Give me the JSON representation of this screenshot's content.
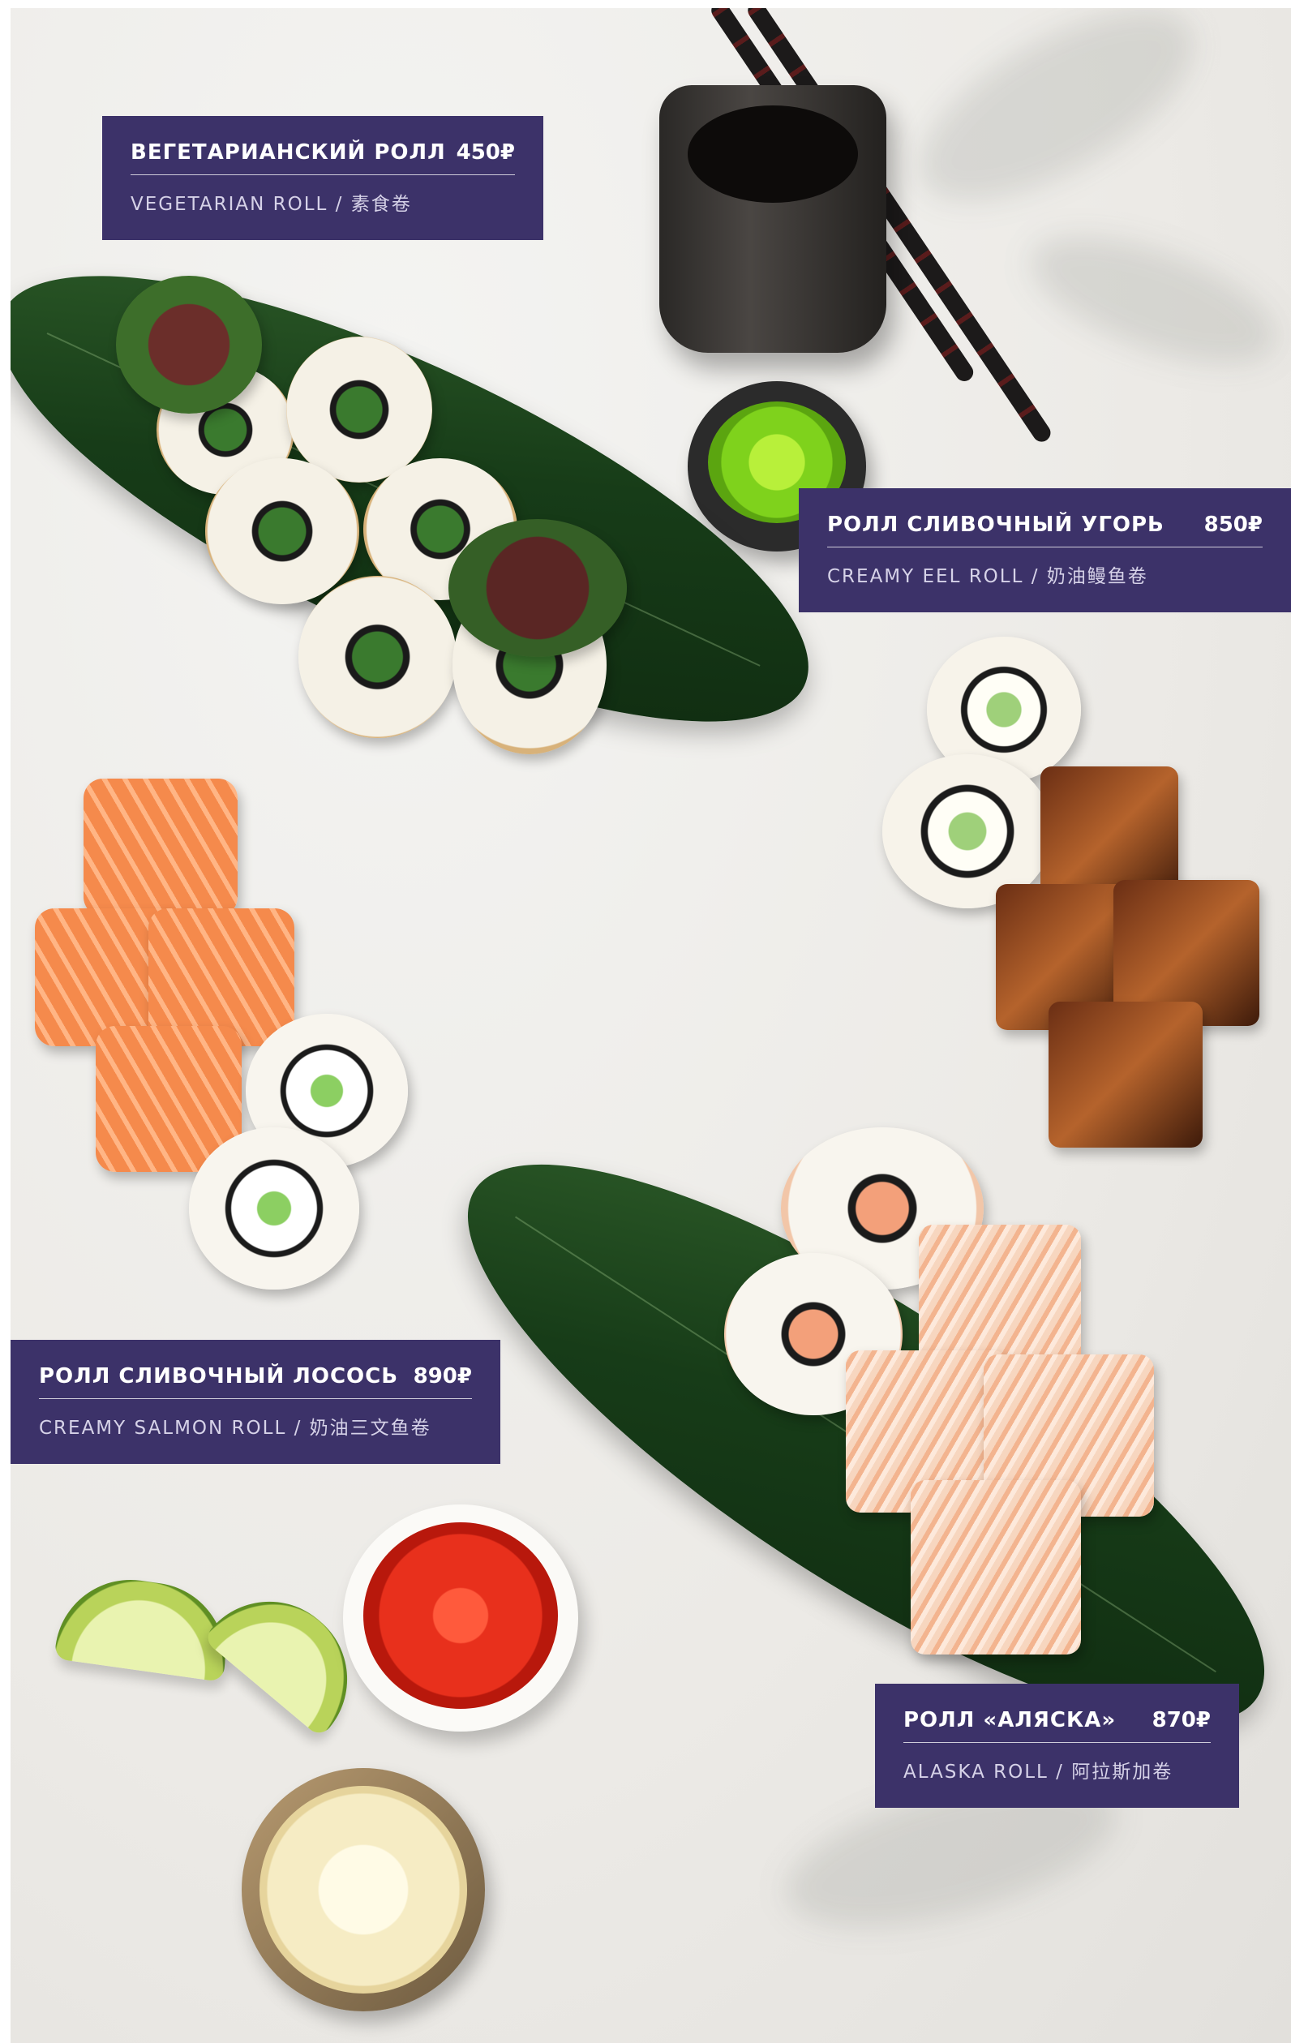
{
  "items": [
    {
      "name": "ВЕГЕТАРИАНСКИЙ РОЛЛ",
      "price": "450₽",
      "subtitle": "VEGETARIAN ROLL / 素食卷"
    },
    {
      "name": "РОЛЛ СЛИВОЧНЫЙ УГОРЬ",
      "price": "850₽",
      "subtitle": "CREAMY EEL ROLL / 奶油鳗鱼卷"
    },
    {
      "name": "РОЛЛ СЛИВОЧНЫЙ ЛОСОСЬ",
      "price": "890₽",
      "subtitle": "CREAMY SALMON ROLL / 奶油三文鱼卷"
    },
    {
      "name": "РОЛЛ «АЛЯСКА»",
      "price": "870₽",
      "subtitle": "ALASKA ROLL / 阿拉斯加卷"
    }
  ],
  "colors": {
    "label_background": "#3c3269",
    "label_text": "#ffffff",
    "label_subtext": "#d6d2e8",
    "page_background": "#ffffff"
  }
}
